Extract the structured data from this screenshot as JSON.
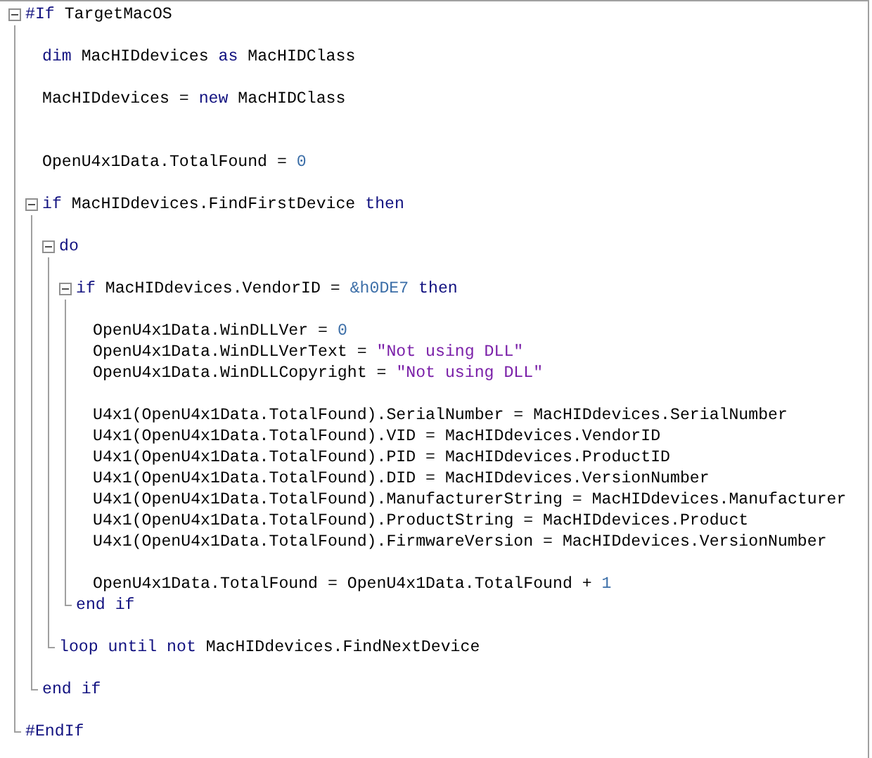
{
  "editor": {
    "items": [
      {
        "kind": "block",
        "expanded": true,
        "header": [
          {
            "kind": "keyword",
            "text": "#If"
          },
          {
            "kind": "plain",
            "text": " TargetMacOS"
          }
        ],
        "children": [
          {
            "kind": "blank"
          },
          {
            "kind": "line",
            "tokens": [
              {
                "kind": "keyword",
                "text": "dim"
              },
              {
                "kind": "plain",
                "text": " MacHIDdevices "
              },
              {
                "kind": "keyword",
                "text": "as"
              },
              {
                "kind": "plain",
                "text": " MacHIDClass"
              }
            ]
          },
          {
            "kind": "blank"
          },
          {
            "kind": "line",
            "tokens": [
              {
                "kind": "plain",
                "text": "MacHIDdevices = "
              },
              {
                "kind": "keyword",
                "text": "new"
              },
              {
                "kind": "plain",
                "text": " MacHIDClass"
              }
            ]
          },
          {
            "kind": "blank"
          },
          {
            "kind": "blank"
          },
          {
            "kind": "line",
            "tokens": [
              {
                "kind": "plain",
                "text": "OpenU4x1Data.TotalFound = "
              },
              {
                "kind": "number",
                "text": "0"
              }
            ]
          },
          {
            "kind": "blank"
          },
          {
            "kind": "block",
            "expanded": true,
            "header": [
              {
                "kind": "keyword",
                "text": "if"
              },
              {
                "kind": "plain",
                "text": " MacHIDdevices.FindFirstDevice "
              },
              {
                "kind": "keyword",
                "text": "then"
              }
            ],
            "children": [
              {
                "kind": "blank"
              },
              {
                "kind": "block",
                "expanded": true,
                "header": [
                  {
                    "kind": "keyword",
                    "text": "do"
                  }
                ],
                "children": [
                  {
                    "kind": "blank"
                  },
                  {
                    "kind": "block",
                    "expanded": true,
                    "header": [
                      {
                        "kind": "keyword",
                        "text": "if"
                      },
                      {
                        "kind": "plain",
                        "text": " MacHIDdevices.VendorID = "
                      },
                      {
                        "kind": "number",
                        "text": "&h0DE7"
                      },
                      {
                        "kind": "keyword",
                        "text": " then"
                      }
                    ],
                    "children": [
                      {
                        "kind": "blank"
                      },
                      {
                        "kind": "line",
                        "tokens": [
                          {
                            "kind": "plain",
                            "text": "OpenU4x1Data.WinDLLVer = "
                          },
                          {
                            "kind": "number",
                            "text": "0"
                          }
                        ]
                      },
                      {
                        "kind": "line",
                        "tokens": [
                          {
                            "kind": "plain",
                            "text": "OpenU4x1Data.WinDLLVerText = "
                          },
                          {
                            "kind": "string",
                            "text": "\"Not using DLL\""
                          }
                        ]
                      },
                      {
                        "kind": "line",
                        "tokens": [
                          {
                            "kind": "plain",
                            "text": "OpenU4x1Data.WinDLLCopyright = "
                          },
                          {
                            "kind": "string",
                            "text": "\"Not using DLL\""
                          }
                        ]
                      },
                      {
                        "kind": "blank"
                      },
                      {
                        "kind": "line",
                        "tokens": [
                          {
                            "kind": "plain",
                            "text": "U4x1(OpenU4x1Data.TotalFound).SerialNumber = MacHIDdevices.SerialNumber"
                          }
                        ]
                      },
                      {
                        "kind": "line",
                        "tokens": [
                          {
                            "kind": "plain",
                            "text": "U4x1(OpenU4x1Data.TotalFound).VID = MacHIDdevices.VendorID"
                          }
                        ]
                      },
                      {
                        "kind": "line",
                        "tokens": [
                          {
                            "kind": "plain",
                            "text": "U4x1(OpenU4x1Data.TotalFound).PID = MacHIDdevices.ProductID"
                          }
                        ]
                      },
                      {
                        "kind": "line",
                        "tokens": [
                          {
                            "kind": "plain",
                            "text": "U4x1(OpenU4x1Data.TotalFound).DID = MacHIDdevices.VersionNumber"
                          }
                        ]
                      },
                      {
                        "kind": "line",
                        "tokens": [
                          {
                            "kind": "plain",
                            "text": "U4x1(OpenU4x1Data.TotalFound).ManufacturerString = MacHIDdevices.Manufacturer"
                          }
                        ]
                      },
                      {
                        "kind": "line",
                        "tokens": [
                          {
                            "kind": "plain",
                            "text": "U4x1(OpenU4x1Data.TotalFound).ProductString = MacHIDdevices.Product"
                          }
                        ]
                      },
                      {
                        "kind": "line",
                        "tokens": [
                          {
                            "kind": "plain",
                            "text": "U4x1(OpenU4x1Data.TotalFound).FirmwareVersion = MacHIDdevices.VersionNumber"
                          }
                        ]
                      },
                      {
                        "kind": "blank"
                      },
                      {
                        "kind": "line",
                        "tokens": [
                          {
                            "kind": "plain",
                            "text": "OpenU4x1Data.TotalFound = OpenU4x1Data.TotalFound + "
                          },
                          {
                            "kind": "number",
                            "text": "1"
                          }
                        ]
                      }
                    ],
                    "footer": [
                      {
                        "kind": "keyword",
                        "text": "end if"
                      }
                    ]
                  },
                  {
                    "kind": "blank"
                  }
                ],
                "footer": [
                  {
                    "kind": "keyword",
                    "text": "loop until not"
                  },
                  {
                    "kind": "plain",
                    "text": " MacHIDdevices.FindNextDevice"
                  }
                ]
              },
              {
                "kind": "blank"
              }
            ],
            "footer": [
              {
                "kind": "keyword",
                "text": "end if"
              }
            ]
          },
          {
            "kind": "blank"
          }
        ],
        "footer": [
          {
            "kind": "keyword",
            "text": "#EndIf"
          }
        ]
      }
    ]
  }
}
